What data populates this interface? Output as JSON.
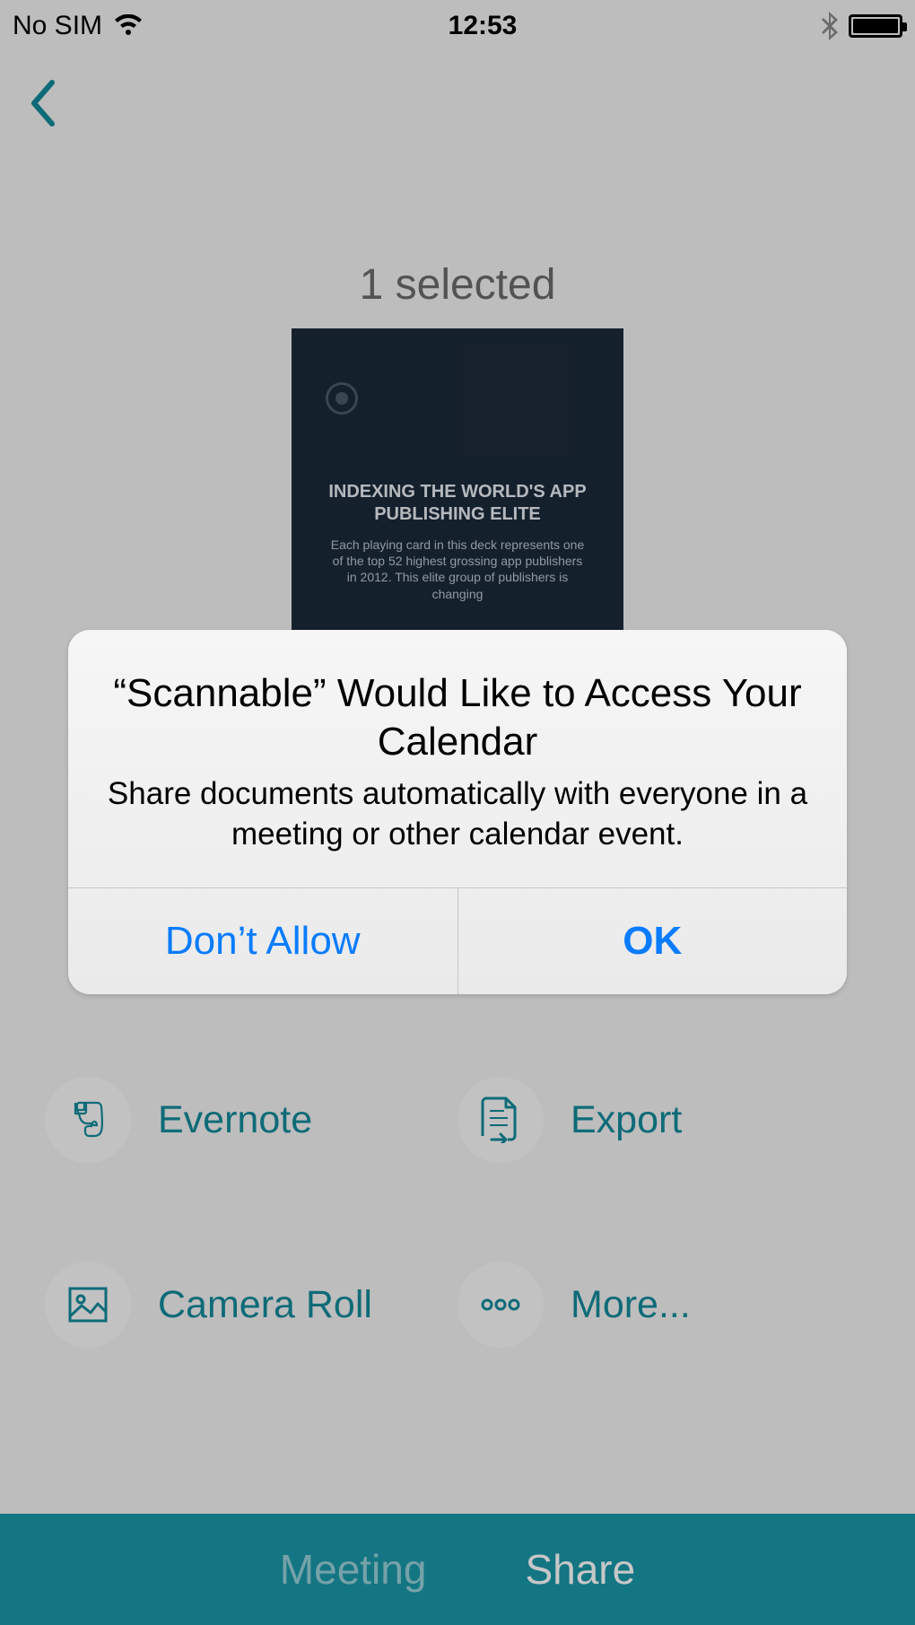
{
  "status_bar": {
    "carrier": "No SIM",
    "time": "12:53"
  },
  "header": {
    "selected_label": "1 selected"
  },
  "scan_preview": {
    "headline": "INDEXING THE WORLD'S APP PUBLISHING ELITE",
    "body": "Each playing card in this deck represents one of the top 52 highest grossing app publishers in 2012. This elite group of publishers is changing"
  },
  "share_options": {
    "evernote": "Evernote",
    "export": "Export",
    "camera_roll": "Camera Roll",
    "more": "More..."
  },
  "bottom_tabs": {
    "meeting": "Meeting",
    "share": "Share"
  },
  "alert": {
    "title": "“Scannable” Would Like to Access Your Calendar",
    "message": "Share documents automatically with everyone in a meeting or other calendar event.",
    "deny": "Don’t Allow",
    "confirm": "OK"
  },
  "colors": {
    "accent": "#138a9a",
    "bottom_bar": "#1a97a8",
    "alert_button": "#0a7cff"
  }
}
